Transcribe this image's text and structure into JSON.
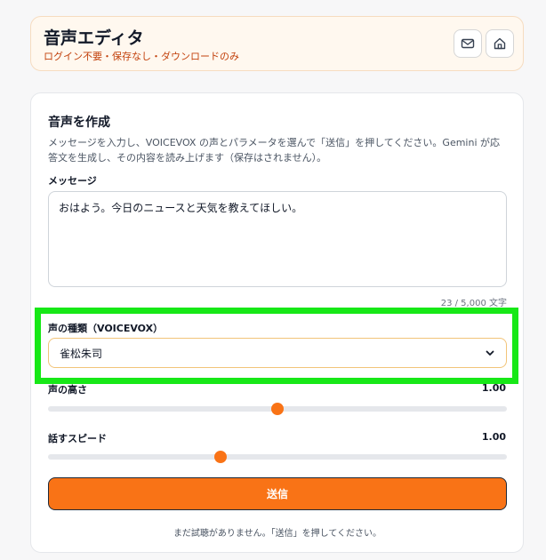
{
  "header": {
    "title": "音声エディタ",
    "subtitle": "ログイン不要・保存なし・ダウンロードのみ",
    "mail_icon": "mail-icon",
    "home_icon": "home-icon"
  },
  "form": {
    "title": "音声を作成",
    "description": "メッセージを入力し、VOICEVOX の声とパラメータを選んで「送信」を押してください。Gemini が応答文を生成し、その内容を読み上げます（保存はされません）。",
    "message_label": "メッセージ",
    "message_value": "おはよう。今日のニュースと天気を教えてほしい。",
    "char_count": "23 / 5,000 文字",
    "voice_label": "声の種類（VOICEVOX）",
    "voice_selected": "雀松朱司",
    "pitch_label": "声の高さ",
    "pitch_value": "1.00",
    "pitch_level": 0.5,
    "speed_label": "話すスピード",
    "speed_value": "1.00",
    "speed_level": 0.375,
    "submit_label": "送信",
    "empty_note": "まだ試聴がありません。「送信」を押してください。"
  },
  "colors": {
    "accent": "#f97316",
    "highlight": "#17e817"
  }
}
